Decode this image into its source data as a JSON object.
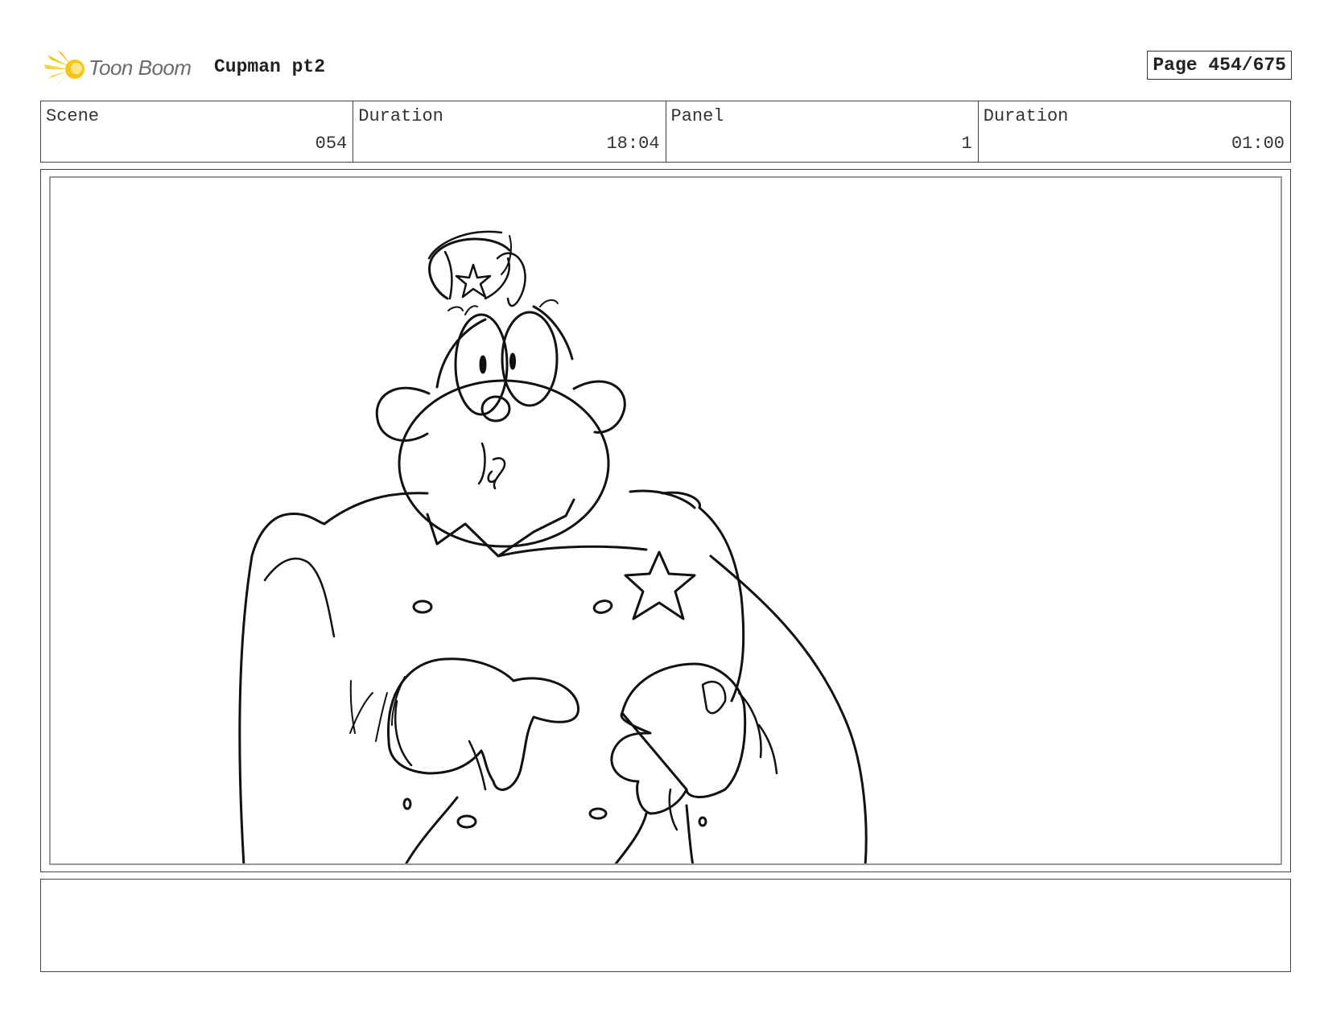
{
  "header": {
    "logo_text": "Toon Boom",
    "project_title": "Cupman pt2",
    "page_label": "Page 454/675"
  },
  "info": [
    {
      "label": "Scene",
      "value": "054"
    },
    {
      "label": "Duration",
      "value": "18:04"
    },
    {
      "label": "Panel",
      "value": "1"
    },
    {
      "label": "Duration",
      "value": "01:00"
    }
  ],
  "notes": {
    "text": ""
  },
  "colors": {
    "logo_accent": "#f5c518",
    "line": "#111111",
    "frame": "#999999"
  },
  "icons": {
    "logo": "toon-boom-logo-icon"
  }
}
